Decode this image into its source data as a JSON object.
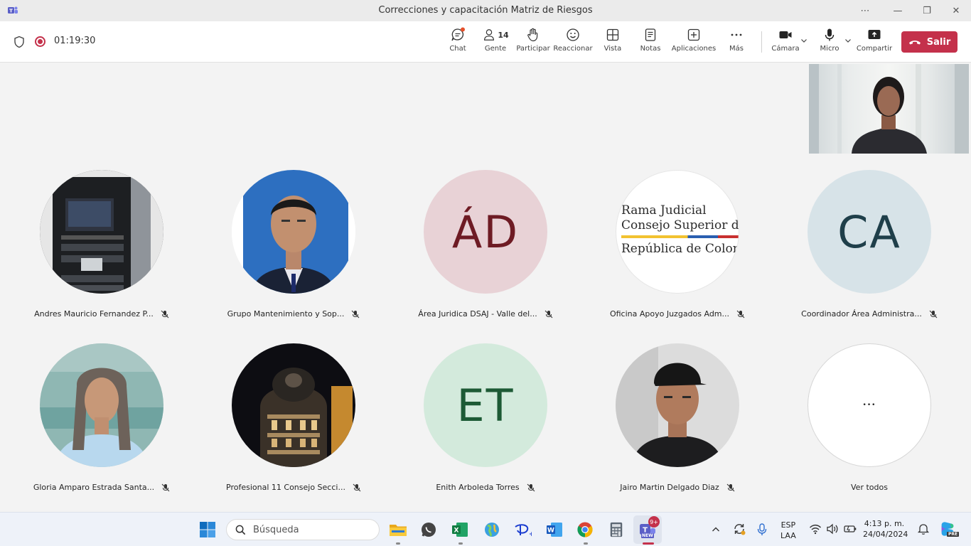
{
  "window": {
    "title": "Correcciones y capacitación Matriz de Riesgos",
    "more": "⋯",
    "minimize": "—",
    "maximize": "❐",
    "close": "✕"
  },
  "meeting": {
    "timer": "01:19:30",
    "participant_count": "14",
    "toolbar": {
      "chat": "Chat",
      "people": "Gente",
      "raise": "Participar",
      "react": "Reaccionar",
      "view": "Vista",
      "notes": "Notas",
      "apps": "Aplicaciones",
      "more": "Más",
      "camera": "Cámara",
      "mic": "Micro",
      "share": "Compartir",
      "leave": "Salir"
    }
  },
  "participants": [
    {
      "name": "Andres Mauricio Fernandez P...",
      "type": "photo-server"
    },
    {
      "name": "Grupo Mantenimiento y Sop...",
      "type": "photo-man"
    },
    {
      "name": "Área Juridica DSAJ - Valle del...",
      "initials": "ÁD",
      "bg": "#e8d2d6",
      "fg": "#6e1b24"
    },
    {
      "name": "Oficina Apoyo Juzgados Adm...",
      "type": "logo",
      "logo_lines": [
        "Rama Judicial",
        "Consejo Superior de",
        "República de Color"
      ]
    },
    {
      "name": "Coordinador Área Administra...",
      "initials": "CA",
      "bg": "#d7e3e8",
      "fg": "#1f3f4a"
    },
    {
      "name": "Gloria Amparo Estrada Santa...",
      "type": "photo-woman"
    },
    {
      "name": "Profesional 11 Consejo Secci...",
      "type": "photo-building"
    },
    {
      "name": "Enith Arboleda Torres",
      "initials": "ET",
      "bg": "#d3eadc",
      "fg": "#1d5a35"
    },
    {
      "name": "Jairo Martin Delgado Diaz",
      "type": "photo-man2"
    },
    {
      "name": "Ver todos",
      "more_glyph": "•••"
    }
  ],
  "taskbar": {
    "search_placeholder": "Búsqueda",
    "lang_top": "ESP",
    "lang_bottom": "LAA",
    "time": "4:13 p. m.",
    "date": "24/04/2024",
    "teams_badge": "9+",
    "teams_new": "NEW",
    "copilot_badge": "PRE"
  },
  "colors": {
    "accent_red": "#c4314b",
    "teams_purple": "#5b5fc7"
  }
}
